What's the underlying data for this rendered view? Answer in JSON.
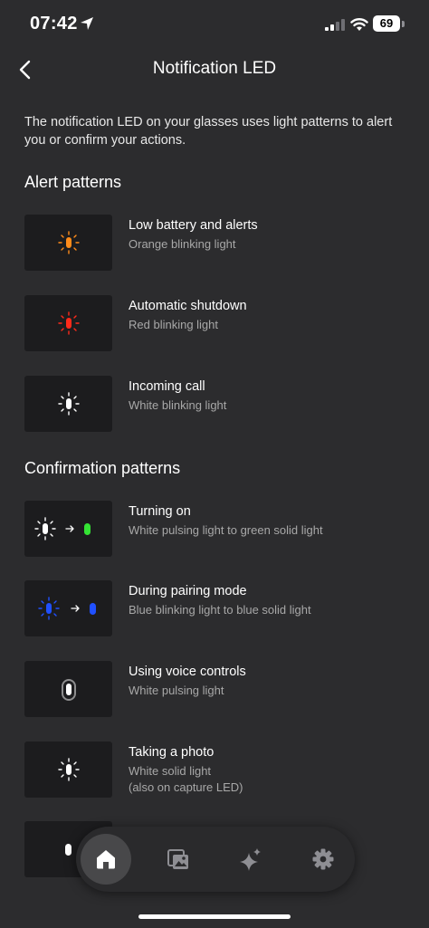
{
  "status": {
    "time": "07:42",
    "battery": "69"
  },
  "header": {
    "title": "Notification LED"
  },
  "intro": "The notification LED on your glasses uses light patterns to alert you or confirm your actions.",
  "sections": {
    "alert": {
      "title": "Alert patterns",
      "items": [
        {
          "title": "Low battery and alerts",
          "subtitle": "Orange blinking light",
          "icon": "orange-led-blinking"
        },
        {
          "title": "Automatic shutdown",
          "subtitle": "Red blinking light",
          "icon": "red-led-blinking"
        },
        {
          "title": "Incoming call",
          "subtitle": "White blinking light",
          "icon": "white-led-blinking"
        }
      ]
    },
    "confirmation": {
      "title": "Confirmation patterns",
      "items": [
        {
          "title": "Turning on",
          "subtitle": "White pulsing light to green solid light",
          "icon": "white-to-green-led"
        },
        {
          "title": "During pairing mode",
          "subtitle": "Blue blinking light to blue solid light",
          "icon": "blue-blinking-to-solid-led"
        },
        {
          "title": "Using voice controls",
          "subtitle": "White pulsing light",
          "icon": "white-pulsing-led"
        },
        {
          "title": "Taking a photo",
          "subtitle": "White solid light",
          "subtitle2": "(also on capture LED)",
          "icon": "white-led-blinking"
        }
      ]
    }
  },
  "tabs": [
    "home-icon",
    "gallery-icon",
    "ai-sparkle-icon",
    "settings-icon"
  ],
  "colors": {
    "background": "#2c2c2e",
    "card": "#1c1c1e",
    "orange": "#ff8c1a",
    "red": "#ff2a1a",
    "white": "#ffffff",
    "green": "#34e334",
    "blue": "#2050ff"
  }
}
